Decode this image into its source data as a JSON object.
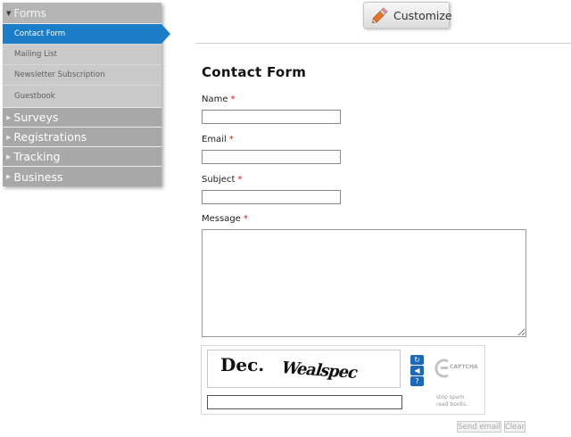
{
  "sidebar": {
    "forms_label": "Forms",
    "forms_items": [
      {
        "label": "Contact Form",
        "active": true
      },
      {
        "label": "Mailing List"
      },
      {
        "label": "Newsletter Subscription"
      },
      {
        "label": "Guestbook"
      }
    ],
    "sections": [
      {
        "label": "Surveys"
      },
      {
        "label": "Registrations"
      },
      {
        "label": "Tracking"
      },
      {
        "label": "Business"
      }
    ]
  },
  "toolbar": {
    "customize_label": "Customize",
    "customize_icon": "pencil-icon"
  },
  "form": {
    "title": "Contact Form",
    "required_mark": "*",
    "name_label": "Name",
    "email_label": "Email",
    "subject_label": "Subject",
    "message_label": "Message",
    "name_value": "",
    "email_value": "",
    "subject_value": "",
    "message_value": ""
  },
  "captcha": {
    "word1": "Dec.",
    "word2": "Wealspec",
    "refresh_icon": "refresh-icon",
    "audio_icon": "audio-icon",
    "help_icon": "help-icon",
    "logo_text": "CAPTCHA",
    "tagline_1": "stop spam.",
    "tagline_2": "read books.",
    "response_value": ""
  },
  "buttons": {
    "send": "Send email",
    "clear": "Clear"
  },
  "colors": {
    "accent": "#1b7dc8",
    "sidebar_header": "#a8a8a8",
    "sidebar_sub": "#c9c9c9",
    "required": "#dd1111",
    "captcha_button": "#1d68b7"
  }
}
